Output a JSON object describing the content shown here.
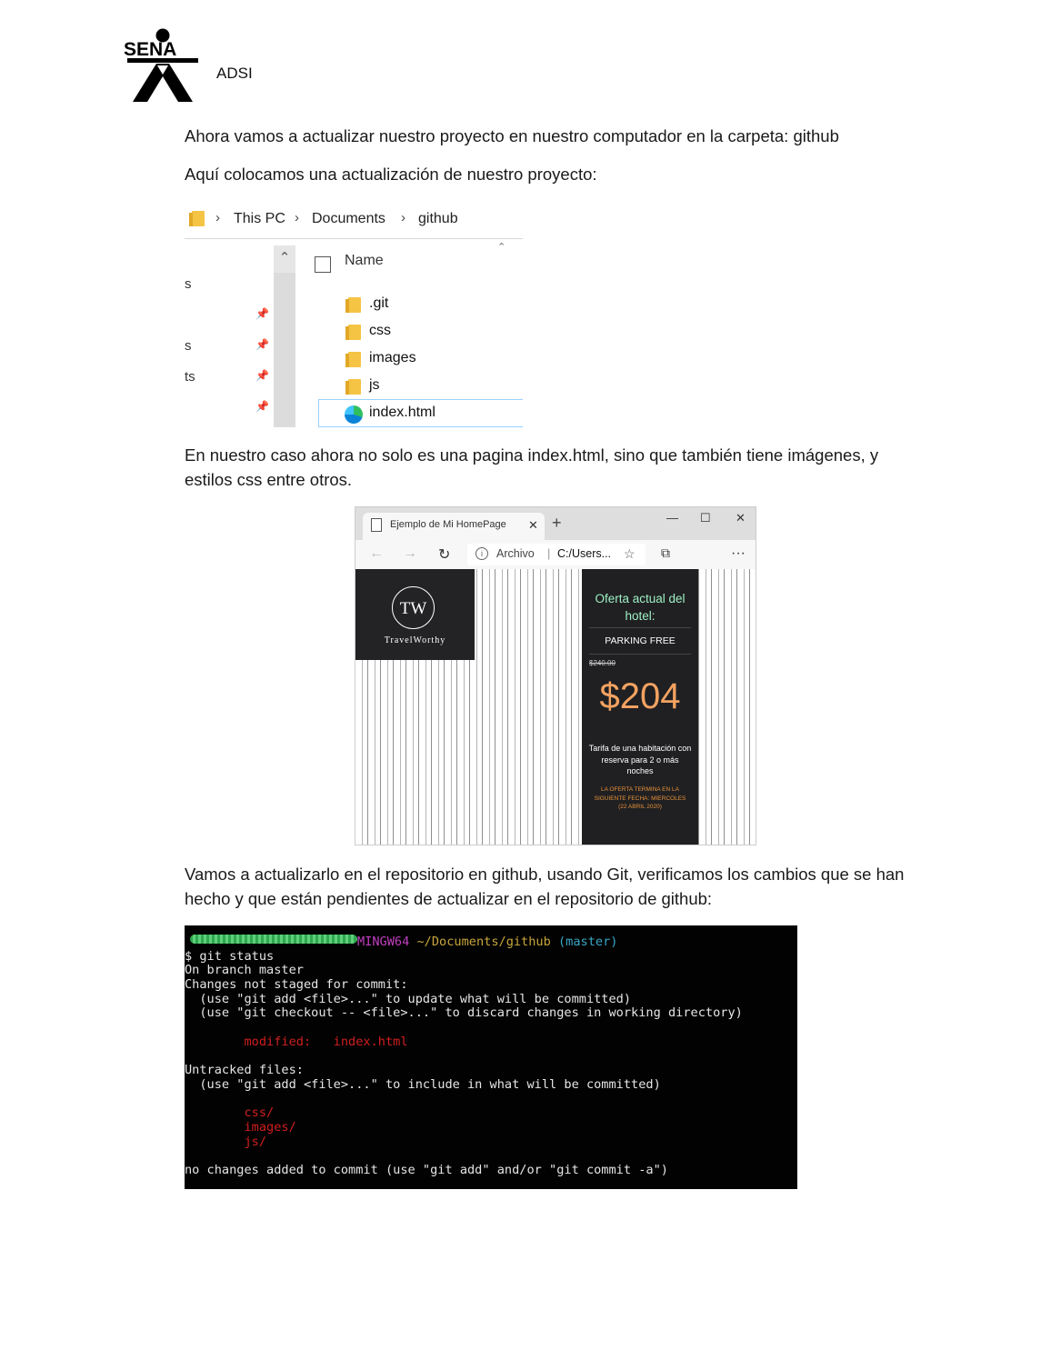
{
  "header": {
    "org": "SENA",
    "label": "ADSI"
  },
  "paragraphs": {
    "p1": "Ahora vamos a actualizar nuestro proyecto en nuestro computador en la carpeta: github",
    "p2": "Aquí colocamos una actualización de nuestro proyecto:",
    "p3": "En nuestro caso ahora no solo es una pagina index.html, sino que también tiene imágenes, y estilos css entre otros.",
    "p4": "Vamos a actualizarlo en el repositorio en github, usando Git, verificamos los cambios que se han hecho y que están pendientes de actualizar en el repositorio de github:"
  },
  "explorer": {
    "breadcrumb": [
      "This PC",
      "Documents",
      "github"
    ],
    "column_header": "Name",
    "nav_fragments": [
      "s",
      "s",
      "ts"
    ],
    "files": [
      {
        "name": ".git",
        "kind": "folder"
      },
      {
        "name": "css",
        "kind": "folder"
      },
      {
        "name": "images",
        "kind": "folder"
      },
      {
        "name": "js",
        "kind": "folder"
      },
      {
        "name": "index.html",
        "kind": "edge-html",
        "selected": true
      }
    ]
  },
  "browser": {
    "tab_title": "Ejemplo de Mi HomePage",
    "address_label": "Archivo",
    "address_url": "C:/Users...",
    "page": {
      "brand_monogram": "TW",
      "brand_name": "TravelWorthy",
      "offer_title": "Oferta actual del hotel:",
      "parking": "PARKING FREE",
      "old_price": "$240.00",
      "price": "$204",
      "rate_text": "Tarifa de una habitación con reserva para 2 o más noches",
      "deal_end": "LA OFERTA TERMINA EN LA SIGUIENTE FECHA: MIERCOLES (22 ABRIL 2020)"
    }
  },
  "terminal": {
    "prompt_env": "MINGW64",
    "prompt_path": "~/Documents/github",
    "prompt_branch": "(master)",
    "lines": [
      "$ git status",
      "On branch master",
      "Changes not staged for commit:",
      "  (use \"git add <file>...\" to update what will be committed)",
      "  (use \"git checkout -- <file>...\" to discard changes in working directory)",
      "",
      "Untracked files:",
      "  (use \"git add <file>...\" to include in what will be committed)",
      "",
      "no changes added to commit (use \"git add\" and/or \"git commit -a\")"
    ],
    "modified": "        modified:   index.html",
    "untracked": [
      "        css/",
      "        images/",
      "        js/"
    ]
  },
  "colors": {
    "terminal_red": "#d11f1f",
    "offer_accent": "#f4a261",
    "offer_title": "#9ff0c4"
  }
}
